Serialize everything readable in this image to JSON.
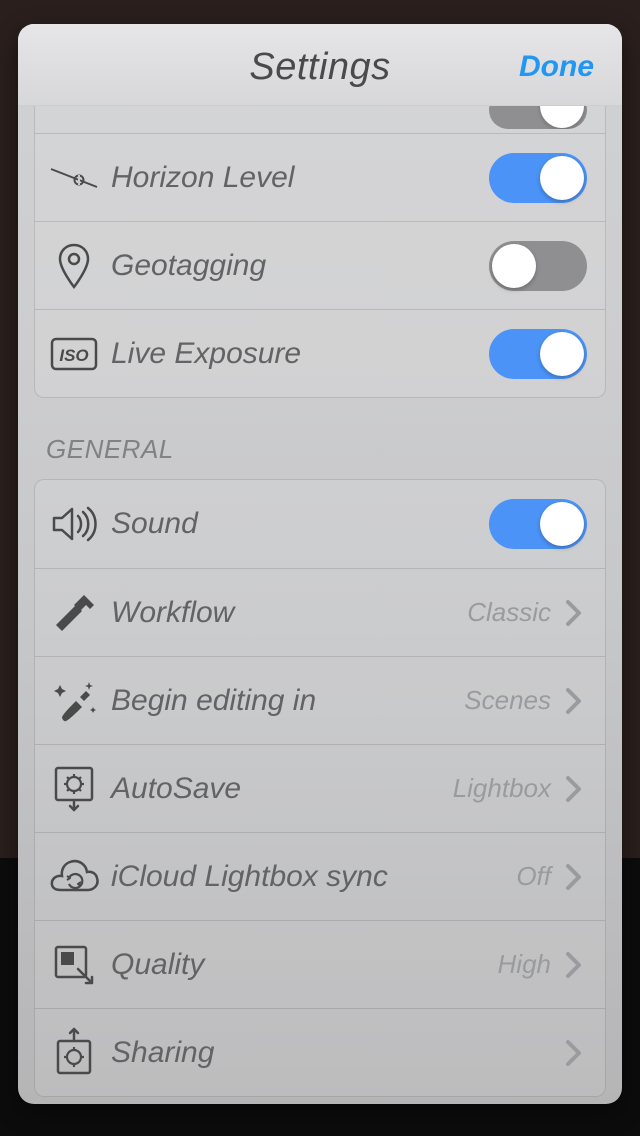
{
  "header": {
    "title": "Settings",
    "done": "Done"
  },
  "camera": {
    "horizon_level": {
      "label": "Horizon Level",
      "on": true
    },
    "geotagging": {
      "label": "Geotagging",
      "on": false
    },
    "live_exposure": {
      "label": "Live Exposure",
      "on": true
    }
  },
  "section_general_title": "GENERAL",
  "general": {
    "sound": {
      "label": "Sound",
      "on": true
    },
    "workflow": {
      "label": "Workflow",
      "value": "Classic"
    },
    "begin_editing": {
      "label": "Begin editing in",
      "value": "Scenes"
    },
    "autosave": {
      "label": "AutoSave",
      "value": "Lightbox"
    },
    "icloud_sync": {
      "label": "iCloud Lightbox sync",
      "value": "Off"
    },
    "quality": {
      "label": "Quality",
      "value": "High"
    },
    "sharing": {
      "label": "Sharing",
      "value": ""
    }
  }
}
